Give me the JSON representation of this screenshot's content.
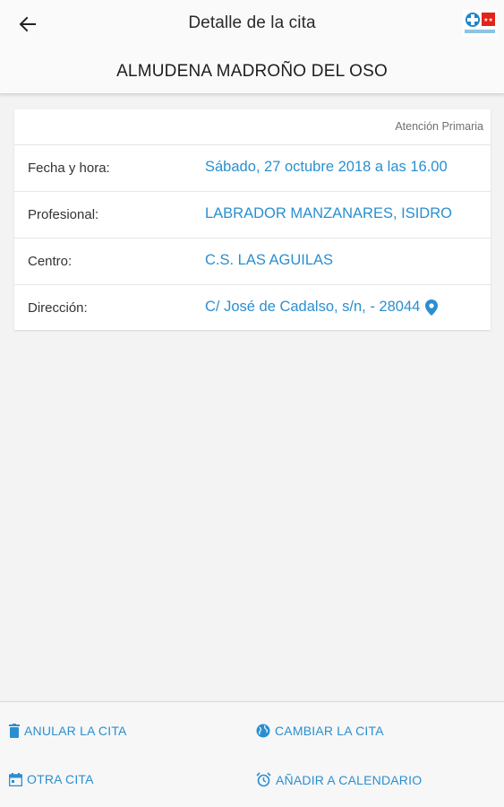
{
  "header": {
    "title": "Detalle de la cita",
    "back_icon": "arrow-left-icon",
    "logo": "Salud Madrid",
    "logo_colors": [
      "#1c87c9",
      "#e2231a"
    ]
  },
  "patient": {
    "name": "ALMUDENA MADROÑO DEL OSO"
  },
  "appointment": {
    "category": "Atención Primaria",
    "rows": [
      {
        "label": "Fecha y hora:",
        "value": "Sábado, 27 octubre 2018 a las 16.00"
      },
      {
        "label": "Profesional:",
        "value": "LABRADOR MANZANARES, ISIDRO"
      },
      {
        "label": "Centro:",
        "value": "C.S. LAS AGUILAS"
      },
      {
        "label": "Dirección:",
        "value": "C/ José de Cadalso, s/n, - 28044",
        "icon": "map-pin-icon"
      }
    ]
  },
  "actions": {
    "cancel": {
      "label": "ANULAR LA CITA",
      "icon": "trash-icon"
    },
    "change": {
      "label": "CAMBIAR LA CITA",
      "icon": "globe-icon"
    },
    "other": {
      "label": "OTRA CITA",
      "icon": "calendar-icon"
    },
    "add_calendar": {
      "label": "AÑADIR A CALENDARIO",
      "icon": "alarm-clock-icon"
    }
  },
  "colors": {
    "accent": "#2a8fd0",
    "background": "#f3f3f3",
    "card": "#ffffff"
  }
}
